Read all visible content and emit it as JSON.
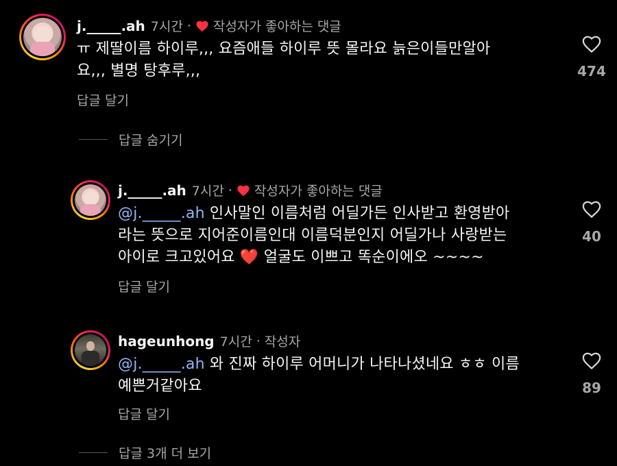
{
  "comments": [
    {
      "username": "j._____.ah",
      "time": "7시간",
      "separator": "·",
      "tag": "작성자가 좋아하는 댓글",
      "text_lines": [
        "ㅠ 제딸이름 하이루,,, 요즘애들 하이루 뜻 몰라요 늙은이들만알아",
        "요,,, 별명 탕후루,,,"
      ],
      "reply_label": "답글 달기",
      "likes": "474"
    },
    {
      "username": "j._____.ah",
      "time": "7시간",
      "separator": "·",
      "tag": "작성자가 좋아하는 댓글",
      "mention": "@j._____.ah",
      "text_lines": [
        " 인사말인 이름처럼 어딜가든 인사받고 환영받아",
        "라는 뜻으로 지어준이름인대 이름덕분인지 어딜가나 사랑받는",
        "아이로 크고있어요"
      ],
      "emoji": "❤️",
      "text_tail": " 얼굴도 이쁘고 똑순이에오 ~~~~",
      "reply_label": "답글 달기",
      "likes": "40"
    },
    {
      "username": "hageunhong",
      "time": "7시간",
      "separator": "·",
      "tag": "작성자",
      "mention": "@j._____.ah",
      "text_lines": [
        " 와 진짜 하이루 어머니가 나타나셨네요 ㅎㅎ 이름",
        "예쁜거같아요"
      ],
      "reply_label": "답글 달기",
      "likes": "89"
    }
  ],
  "thread": {
    "hide_replies": "답글 숨기기",
    "more_replies": "답글 3개 더 보기"
  },
  "icons": {
    "liked_by_author": "red-heart-icon",
    "like": "heart-outline-icon"
  },
  "colors": {
    "background": "#000000",
    "text": "#f5f5f5",
    "secondary": "#a8a8a8",
    "mention": "#8fb8f7",
    "heart": "#ff3040"
  }
}
